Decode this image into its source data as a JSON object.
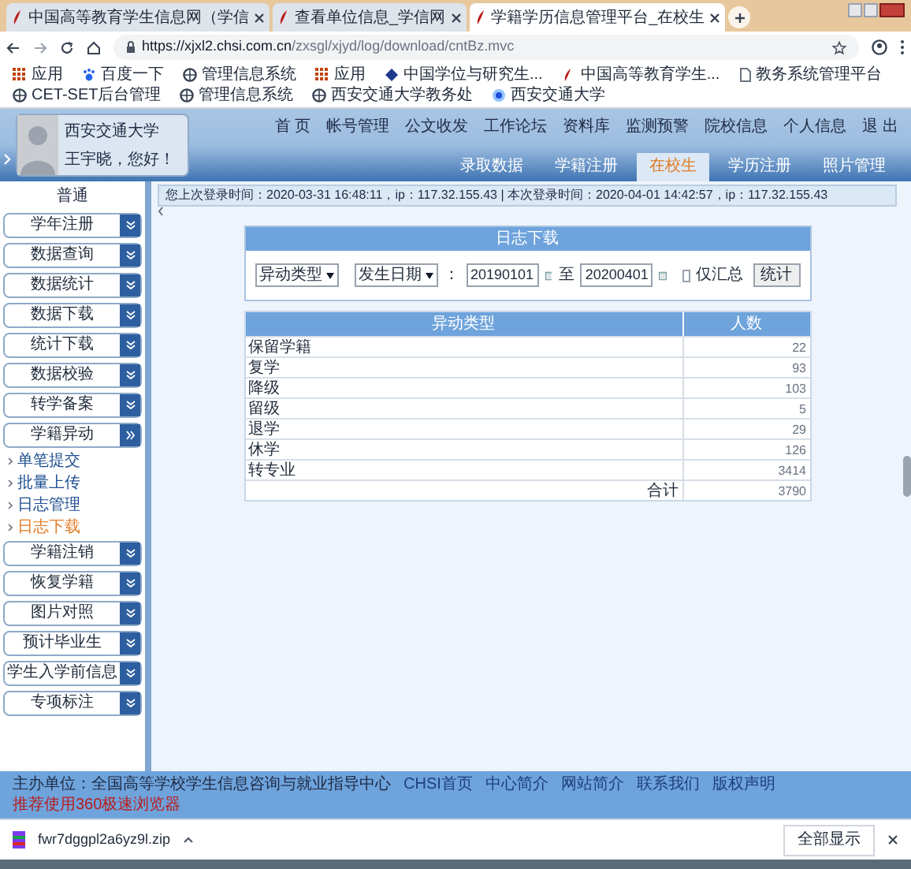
{
  "browser": {
    "tabs": [
      {
        "title": "中国高等教育学生信息网（学信",
        "selected": false
      },
      {
        "title": "查看单位信息_学信网",
        "selected": false
      },
      {
        "title": "学籍学历信息管理平台_在校生",
        "selected": true
      }
    ],
    "url": {
      "domain": "https://xjxl2.chsi.com.cn",
      "path": "/zxsgl/xjyd/log/download/cntBz.mvc"
    },
    "bookmarks": [
      {
        "label": "应用",
        "kind": "apps"
      },
      {
        "label": "百度一下",
        "kind": "paw"
      },
      {
        "label": "管理信息系统",
        "kind": "globe"
      },
      {
        "label": "应用",
        "kind": "apps"
      },
      {
        "label": "中国学位与研究生...",
        "kind": "diamond"
      },
      {
        "label": "中国高等教育学生...",
        "kind": "chsi"
      },
      {
        "label": "教务系统管理平台",
        "kind": "page"
      },
      {
        "label": "CET-SET后台管理",
        "kind": "globe"
      },
      {
        "label": "管理信息系统",
        "kind": "globe"
      },
      {
        "label": "西安交通大学教务处",
        "kind": "globe"
      },
      {
        "label": "西安交通大学",
        "kind": "seal"
      }
    ]
  },
  "header": {
    "school": "西安交通大学",
    "greeting": "王宇晓，您好！",
    "top_links": [
      "首 页",
      "帐号管理",
      "公文收发",
      "工作论坛",
      "资料库",
      "监测预警",
      "院校信息",
      "个人信息",
      "退 出"
    ],
    "nav_tabs": [
      {
        "label": "录取数据",
        "selected": false
      },
      {
        "label": "学籍注册",
        "selected": false
      },
      {
        "label": "在校生",
        "selected": true
      },
      {
        "label": "学历注册",
        "selected": false
      },
      {
        "label": "照片管理",
        "selected": false
      }
    ]
  },
  "sidebar": {
    "heading": "普通",
    "items": [
      {
        "label": "学年注册",
        "expanded": false
      },
      {
        "label": "数据查询",
        "expanded": false
      },
      {
        "label": "数据统计",
        "expanded": false
      },
      {
        "label": "数据下载",
        "expanded": false
      },
      {
        "label": "统计下载",
        "expanded": false
      },
      {
        "label": "数据校验",
        "expanded": false
      },
      {
        "label": "转学备案",
        "expanded": false
      },
      {
        "label": "学籍异动",
        "expanded": true,
        "children": [
          {
            "label": "单笔提交",
            "selected": false
          },
          {
            "label": "批量上传",
            "selected": false
          },
          {
            "label": "日志管理",
            "selected": false
          },
          {
            "label": "日志下载",
            "selected": true
          }
        ]
      },
      {
        "label": "学籍注销",
        "expanded": false
      },
      {
        "label": "恢复学籍",
        "expanded": false
      },
      {
        "label": "图片对照",
        "expanded": false
      },
      {
        "label": "预计毕业生",
        "expanded": false
      },
      {
        "label": "学生入学前信息",
        "expanded": false
      },
      {
        "label": "专项标注",
        "expanded": false
      }
    ]
  },
  "login_info": "您上次登录时间：2020-03-31 16:48:11，ip：117.32.155.43 | 本次登录时间：2020-04-01 14:42:57，ip：117.32.155.43",
  "panel": {
    "title": "日志下载",
    "filters": {
      "type_select": "异动类型",
      "date_select": "发生日期",
      "colon": "：",
      "from": "20190101",
      "to_label": "至",
      "to": "20200401",
      "checkbox": {
        "label": "仅汇总",
        "checked": false
      },
      "button": "统计"
    },
    "table": {
      "columns": [
        "异动类型",
        "人数"
      ],
      "rows": [
        [
          "保留学籍",
          "22"
        ],
        [
          "复学",
          "93"
        ],
        [
          "降级",
          "103"
        ],
        [
          "留级",
          "5"
        ],
        [
          "退学",
          "29"
        ],
        [
          "休学",
          "126"
        ],
        [
          "转专业",
          "3414"
        ]
      ],
      "total_label": "合计",
      "total": "3790"
    }
  },
  "footer": {
    "sponsor": "主办单位：全国高等学校学生信息咨询与就业指导中心",
    "links": [
      "CHSI首页",
      "中心简介",
      "网站简介",
      "联系我们",
      "版权声明"
    ],
    "recommend": "推荐使用360极速浏览器"
  },
  "downloads": {
    "file": "fwr7dggpl2a6yz9l.zip",
    "show_all": "全部显示"
  }
}
